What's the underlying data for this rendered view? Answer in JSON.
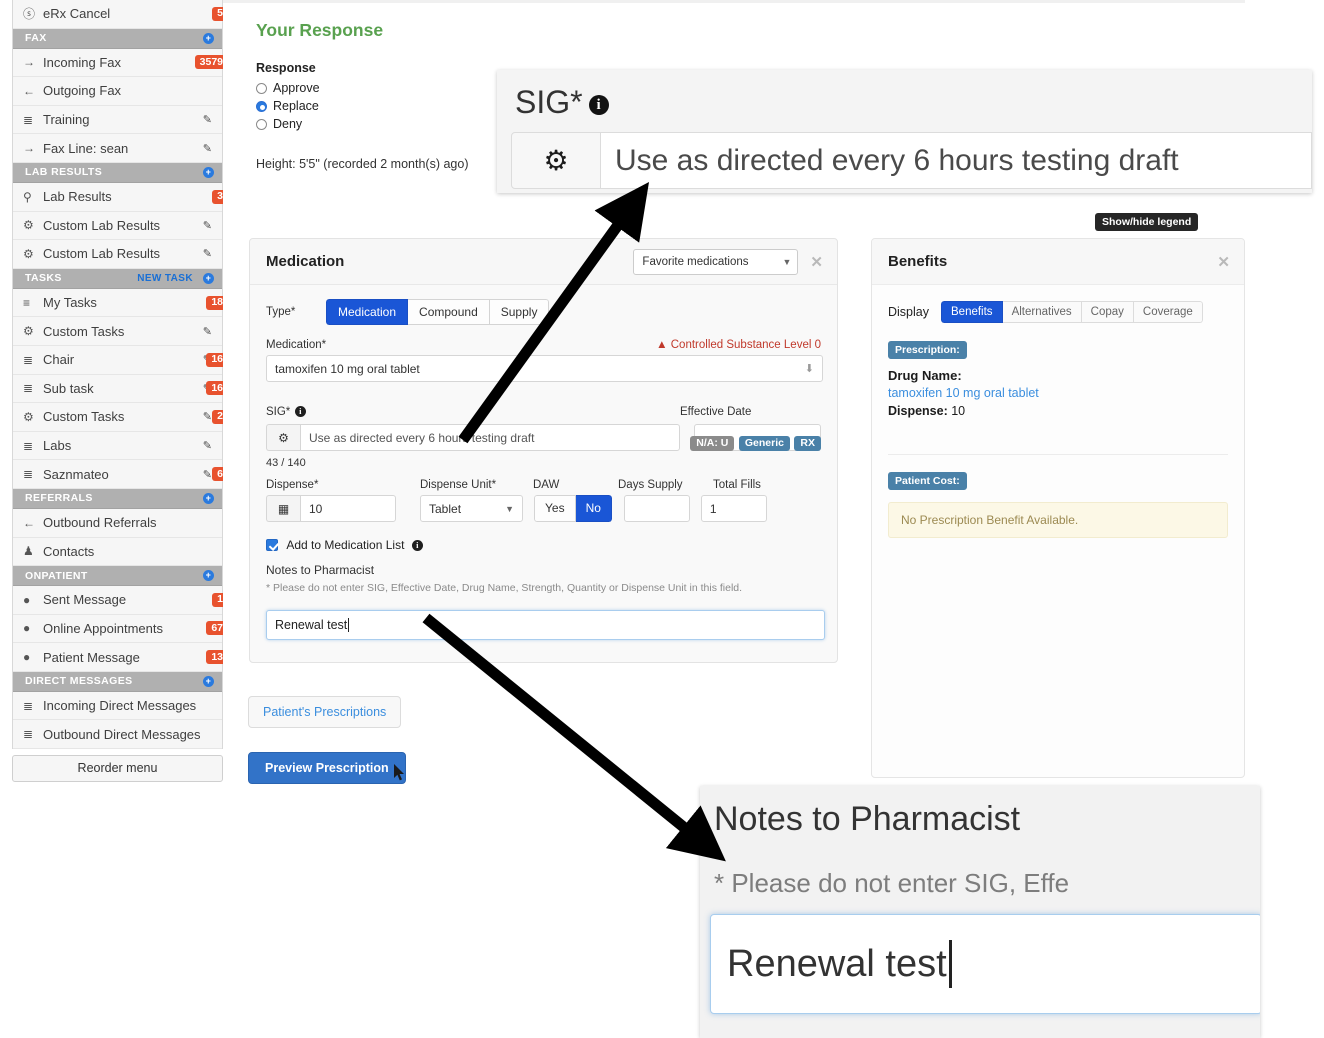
{
  "colors": {
    "accent_blue": "#1a56d6",
    "green_heading": "#59a14f",
    "badge_orange": "#e8522e",
    "warn_red": "#c0392b",
    "pill_blue": "#4a81a8",
    "pill_grey": "#8b8b8b"
  },
  "sidebar": {
    "items": [
      {
        "label": "eRx Cancel",
        "icon": "cancel-circle-icon",
        "badge": "5"
      },
      {
        "label": "FAX",
        "type": "header",
        "icon": "plus-circle-icon"
      },
      {
        "label": "Incoming Fax",
        "icon": "arrow-right-icon",
        "badge": "3579"
      },
      {
        "label": "Outgoing Fax",
        "icon": "arrow-left-icon"
      },
      {
        "label": "Training",
        "icon": "list-icon",
        "edit": true
      },
      {
        "label": "Fax Line: sean",
        "icon": "arrow-right-icon",
        "edit": true
      },
      {
        "label": "LAB RESULTS",
        "type": "header",
        "icon": "plus-circle-icon"
      },
      {
        "label": "Lab Results",
        "icon": "flask-icon",
        "badge": "3"
      },
      {
        "label": "Custom Lab Results",
        "icon": "gear-icon",
        "edit": true
      },
      {
        "label": "Custom Lab Results",
        "icon": "gear-icon",
        "edit": true
      },
      {
        "label": "TASKS",
        "type": "header",
        "icon": "plus-circle-icon",
        "action": "NEW TASK"
      },
      {
        "label": "My Tasks",
        "icon": "menu-icon",
        "badge": "18"
      },
      {
        "label": "Custom Tasks",
        "icon": "gear-icon",
        "edit": true
      },
      {
        "label": "Chair",
        "icon": "list-icon",
        "edit": true,
        "badge": "16"
      },
      {
        "label": "Sub task",
        "icon": "list-icon",
        "edit": true,
        "badge": "16"
      },
      {
        "label": "Custom Tasks",
        "icon": "gear-icon",
        "edit": true,
        "badge": "2"
      },
      {
        "label": "Labs",
        "icon": "list-icon",
        "edit": true
      },
      {
        "label": "Saznmateo",
        "icon": "list-icon",
        "edit": true,
        "badge": "6"
      },
      {
        "label": "REFERRALS",
        "type": "header",
        "icon": "plus-circle-icon"
      },
      {
        "label": "Outbound Referrals",
        "icon": "arrow-left-icon"
      },
      {
        "label": "Contacts",
        "icon": "person-icon"
      },
      {
        "label": "ONPATIENT",
        "type": "header",
        "icon": "plus-circle-icon"
      },
      {
        "label": "Sent Message",
        "icon": "dot-icon",
        "badge": "1"
      },
      {
        "label": "Online Appointments",
        "icon": "dot-icon",
        "badge": "67"
      },
      {
        "label": "Patient Message",
        "icon": "dot-icon",
        "badge": "13"
      },
      {
        "label": "DIRECT MESSAGES",
        "type": "header",
        "icon": "plus-circle-icon"
      },
      {
        "label": "Incoming Direct Messages",
        "icon": "list-icon"
      },
      {
        "label": "Outbound Direct Messages",
        "icon": "list-icon"
      }
    ],
    "reorder_menu": "Reorder menu"
  },
  "response": {
    "heading": "Your Response",
    "label": "Response",
    "options": [
      "Approve",
      "Replace",
      "Deny"
    ],
    "selected": "Replace",
    "height_line": "Height: 5'5\" (recorded 2 month(s) ago)"
  },
  "medication": {
    "title": "Medication",
    "favorites_select": "Favorite medications",
    "close_icon": "close-icon",
    "type_label": "Type*",
    "type_tabs": [
      "Medication",
      "Compound",
      "Supply"
    ],
    "type_selected": "Medication",
    "medication_label": "Medication*",
    "controlled_warning": "Controlled Substance Level 0",
    "medication_value": "tamoxifen 10 mg oral tablet",
    "pills": [
      "N/A: U",
      "Generic",
      "RX"
    ],
    "effective_date_label": "Effective Date",
    "effective_date_value": "",
    "sig_label": "SIG*",
    "sig_value": "Use as directed every 6 hours testing draft",
    "sig_counter": "43 / 140",
    "dispense_label": "Dispense*",
    "dispense_value": "10",
    "dispense_unit_label": "Dispense Unit*",
    "dispense_unit_value": "Tablet",
    "daw_label": "DAW",
    "daw_options": [
      "Yes",
      "No"
    ],
    "daw_selected": "No",
    "days_supply_label": "Days Supply",
    "days_supply_value": "",
    "total_fills_label": "Total Fills",
    "total_fills_value": "1",
    "add_to_list_label": "Add to Medication List",
    "add_to_list_checked": true,
    "notes_label": "Notes to Pharmacist",
    "notes_hint": "* Please do not enter SIG, Effective Date, Drug Name, Strength, Quantity or Dispense Unit in this field.",
    "notes_value": "Renewal test"
  },
  "benefits": {
    "legend_tooltip": "Show/hide legend",
    "title": "Benefits",
    "close_icon": "close-icon",
    "display_label": "Display",
    "tabs": [
      "Benefits",
      "Alternatives",
      "Copay",
      "Coverage"
    ],
    "tab_selected": "Benefits",
    "prescription_section": "Prescription:",
    "drug_name_label": "Drug Name:",
    "drug_name_value": "tamoxifen 10 mg oral tablet",
    "dispense_label": "Dispense:",
    "dispense_value": "10",
    "patient_cost_section": "Patient Cost:",
    "no_benefit_message": "No Prescription Benefit Available."
  },
  "actions": {
    "patients_prescriptions": "Patient's Prescriptions",
    "preview_prescription": "Preview Prescription"
  },
  "callouts": {
    "sig": {
      "label": "SIG*",
      "gear_icon": "gear-icon",
      "value": "Use as directed every 6 hours testing draft"
    },
    "notes": {
      "title": "Notes to Pharmacist",
      "hint": "* Please do not enter SIG, Effe",
      "value": "Renewal test"
    }
  }
}
